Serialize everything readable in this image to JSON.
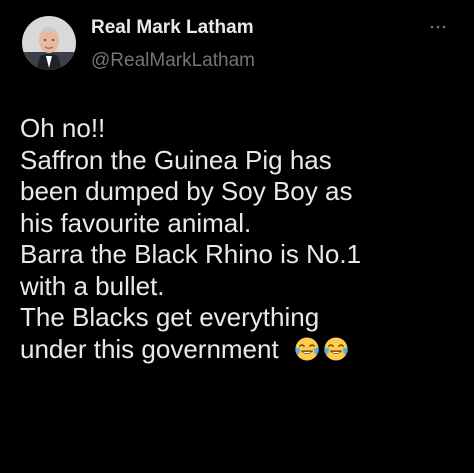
{
  "author": {
    "name": "Real Mark Latham",
    "handle": "@RealMarkLatham"
  },
  "menu": {
    "icon": "more-horizontal-icon"
  },
  "tweet": {
    "lines": [
      "Oh no!!",
      "Saffron the Guinea Pig has",
      "been dumped by Soy Boy as",
      "his favourite animal.",
      "Barra the Black Rhino is No.1",
      "with a bullet.",
      "The Blacks get everything",
      "under this government"
    ],
    "trailing_emojis": [
      "face-with-tears-of-joy-emoji",
      "face-with-tears-of-joy-emoji"
    ]
  },
  "colors": {
    "background": "#000000",
    "text_primary": "#e7e9ea",
    "text_secondary": "#71767b"
  }
}
